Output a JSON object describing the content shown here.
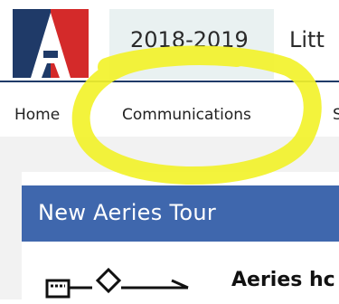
{
  "header": {
    "school_year": "2018-2019",
    "school_name": "Litt"
  },
  "nav": {
    "items": [
      {
        "label": "Home"
      },
      {
        "label": "Communications"
      },
      {
        "label": "S"
      }
    ]
  },
  "card": {
    "title": "New Aeries Tour",
    "text": "Aeries hc"
  },
  "colors": {
    "brand_blue": "#1f3a68",
    "brand_red": "#d42a2a",
    "header_blue": "#3f67ad",
    "highlight_yellow": "#f2f22b"
  }
}
